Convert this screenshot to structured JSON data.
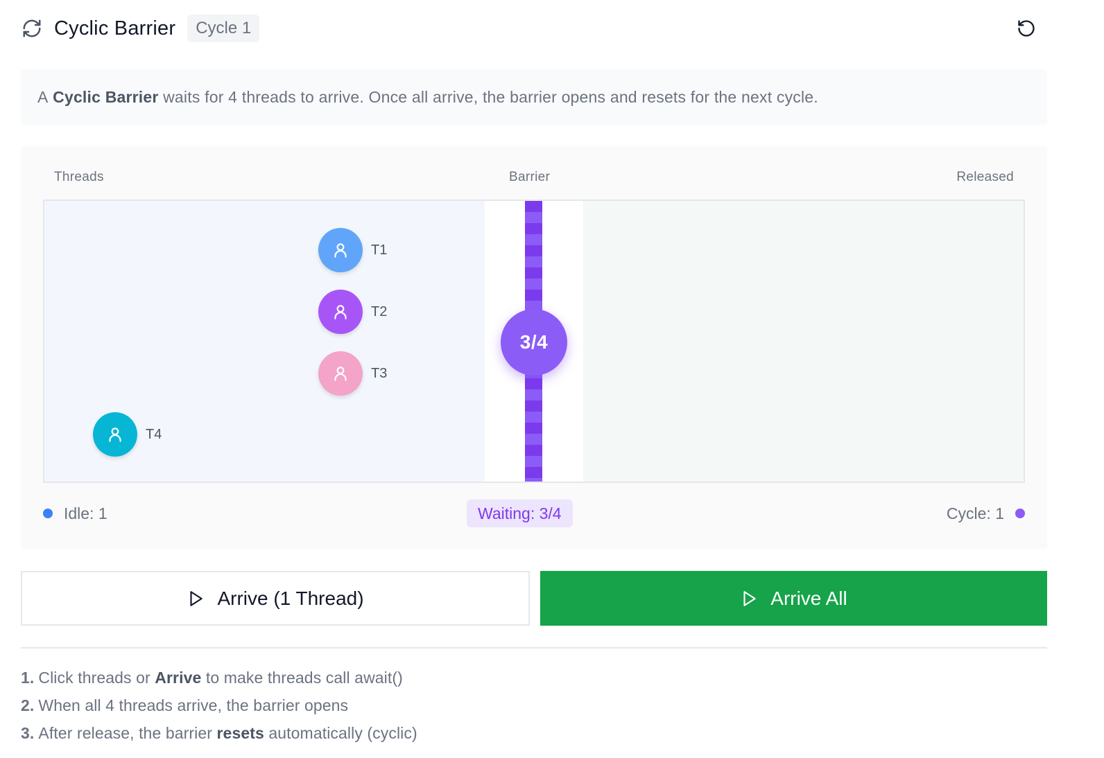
{
  "header": {
    "icon": "refresh-cycle-icon",
    "title": "Cyclic Barrier",
    "cycle_badge": "Cycle 1",
    "reset_icon": "reset-icon"
  },
  "info": {
    "prefix": "A",
    "term": "Cyclic Barrier",
    "text": "waits for 4 threads to arrive. Once all arrive, the barrier opens and resets for the next cycle."
  },
  "visualization": {
    "labels": {
      "threads": "Threads",
      "barrier": "Barrier",
      "released": "Released"
    },
    "counter": "3/4",
    "threads": [
      {
        "name": "T1",
        "state": "waiting",
        "color": "#60a5fa"
      },
      {
        "name": "T2",
        "state": "waiting",
        "color": "#a855f7"
      },
      {
        "name": "T3",
        "state": "waiting",
        "color": "#f4a3c9"
      },
      {
        "name": "T4",
        "state": "idle",
        "color": "#06b6d4"
      }
    ],
    "colors": {
      "barrier": "#7c3aed",
      "counter": "#8b5cf6",
      "idle_dot": "#3b82f6",
      "cycle_dot": "#8b5cf6"
    }
  },
  "stats": {
    "idle": "Idle: 1",
    "waiting": "Waiting: 3/4",
    "cycle": "Cycle: 1"
  },
  "buttons": {
    "arrive_one": "Arrive (1 Thread)",
    "arrive_all": "Arrive All",
    "arrive_all_color": "#16a34a"
  },
  "steps": [
    {
      "num": "1.",
      "before": "Click threads or",
      "bold": "Arrive",
      "after": "to make threads call await()"
    },
    {
      "num": "2.",
      "text": "When all 4 threads arrive, the barrier opens"
    },
    {
      "num": "3.",
      "before": "After release, the barrier",
      "bold": "resets",
      "after": "automatically (cyclic)"
    }
  ]
}
